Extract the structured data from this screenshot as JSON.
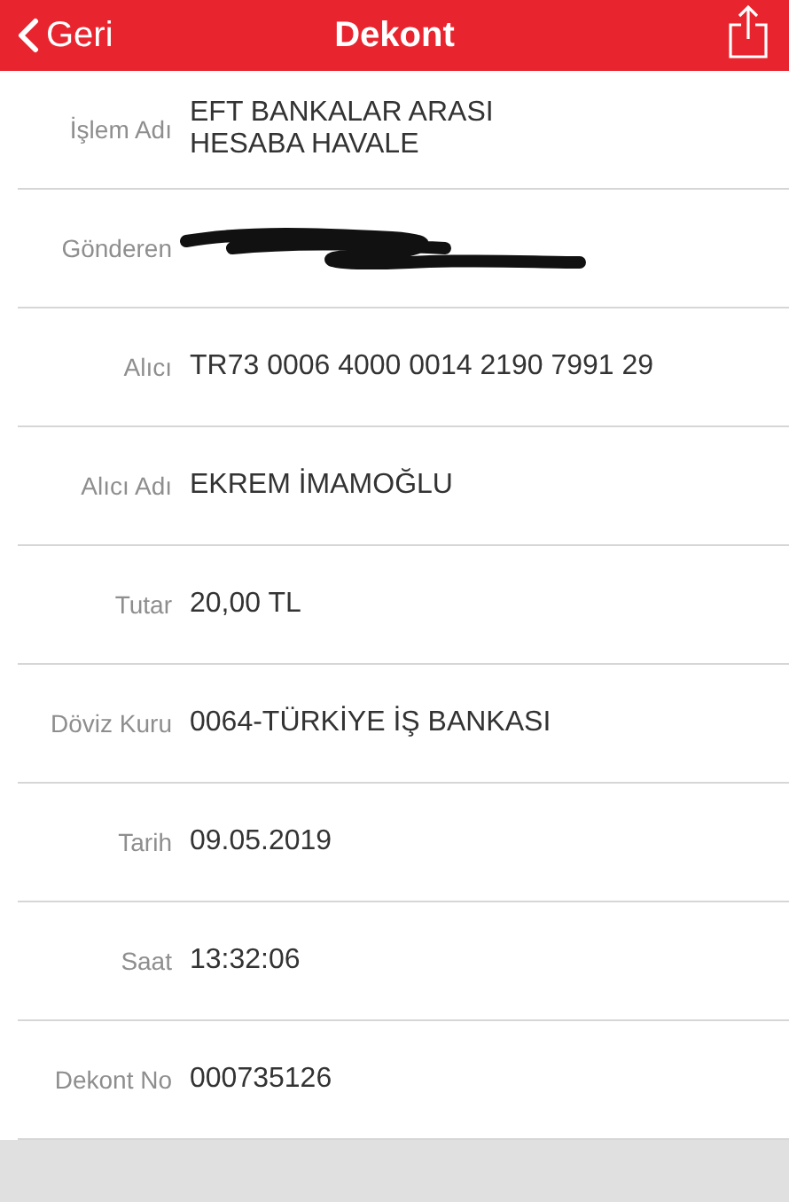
{
  "header": {
    "back": "Geri",
    "title": "Dekont"
  },
  "rows": [
    {
      "label": "İşlem Adı",
      "kind": "text",
      "value": "EFT BANKALAR ARASI\nHESABA HAVALE"
    },
    {
      "label": "Gönderen",
      "kind": "redacted"
    },
    {
      "label": "Alıcı",
      "kind": "text",
      "value": "TR73 0006 4000 0014 2190 7991 29"
    },
    {
      "label": "Alıcı Adı",
      "kind": "text",
      "value": "EKREM İMAMOĞLU"
    },
    {
      "label": "Tutar",
      "kind": "text",
      "value": "20,00 TL"
    },
    {
      "label": "Döviz Kuru",
      "kind": "text",
      "value": "0064-TÜRKİYE İŞ BANKASI"
    },
    {
      "label": "Tarih",
      "kind": "text",
      "value": "09.05.2019"
    },
    {
      "label": "Saat",
      "kind": "text",
      "value": "13:32:06"
    },
    {
      "label": "Dekont No",
      "kind": "text",
      "value": "000735126"
    }
  ]
}
